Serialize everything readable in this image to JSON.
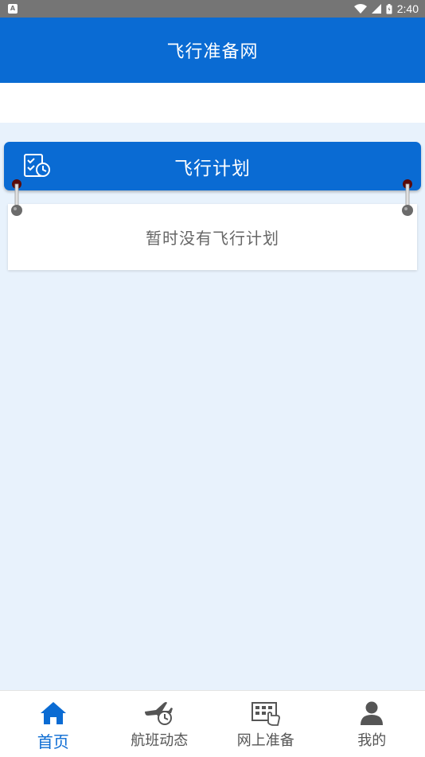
{
  "status_bar": {
    "notification_letter": "A",
    "time": "2:40"
  },
  "header": {
    "title": "飞行准备网"
  },
  "flight_plan": {
    "title": "飞行计划",
    "empty_text": "暂时没有飞行计划"
  },
  "tabs": [
    {
      "label": "首页",
      "icon": "home-icon",
      "active": true
    },
    {
      "label": "航班动态",
      "icon": "plane-clock-icon",
      "active": false
    },
    {
      "label": "网上准备",
      "icon": "calendar-hand-icon",
      "active": false
    },
    {
      "label": "我的",
      "icon": "user-icon",
      "active": false
    }
  ],
  "colors": {
    "primary": "#0a6bd3",
    "background": "#e8f2fc",
    "status_bar": "#757575",
    "inactive_tab": "#555555"
  }
}
